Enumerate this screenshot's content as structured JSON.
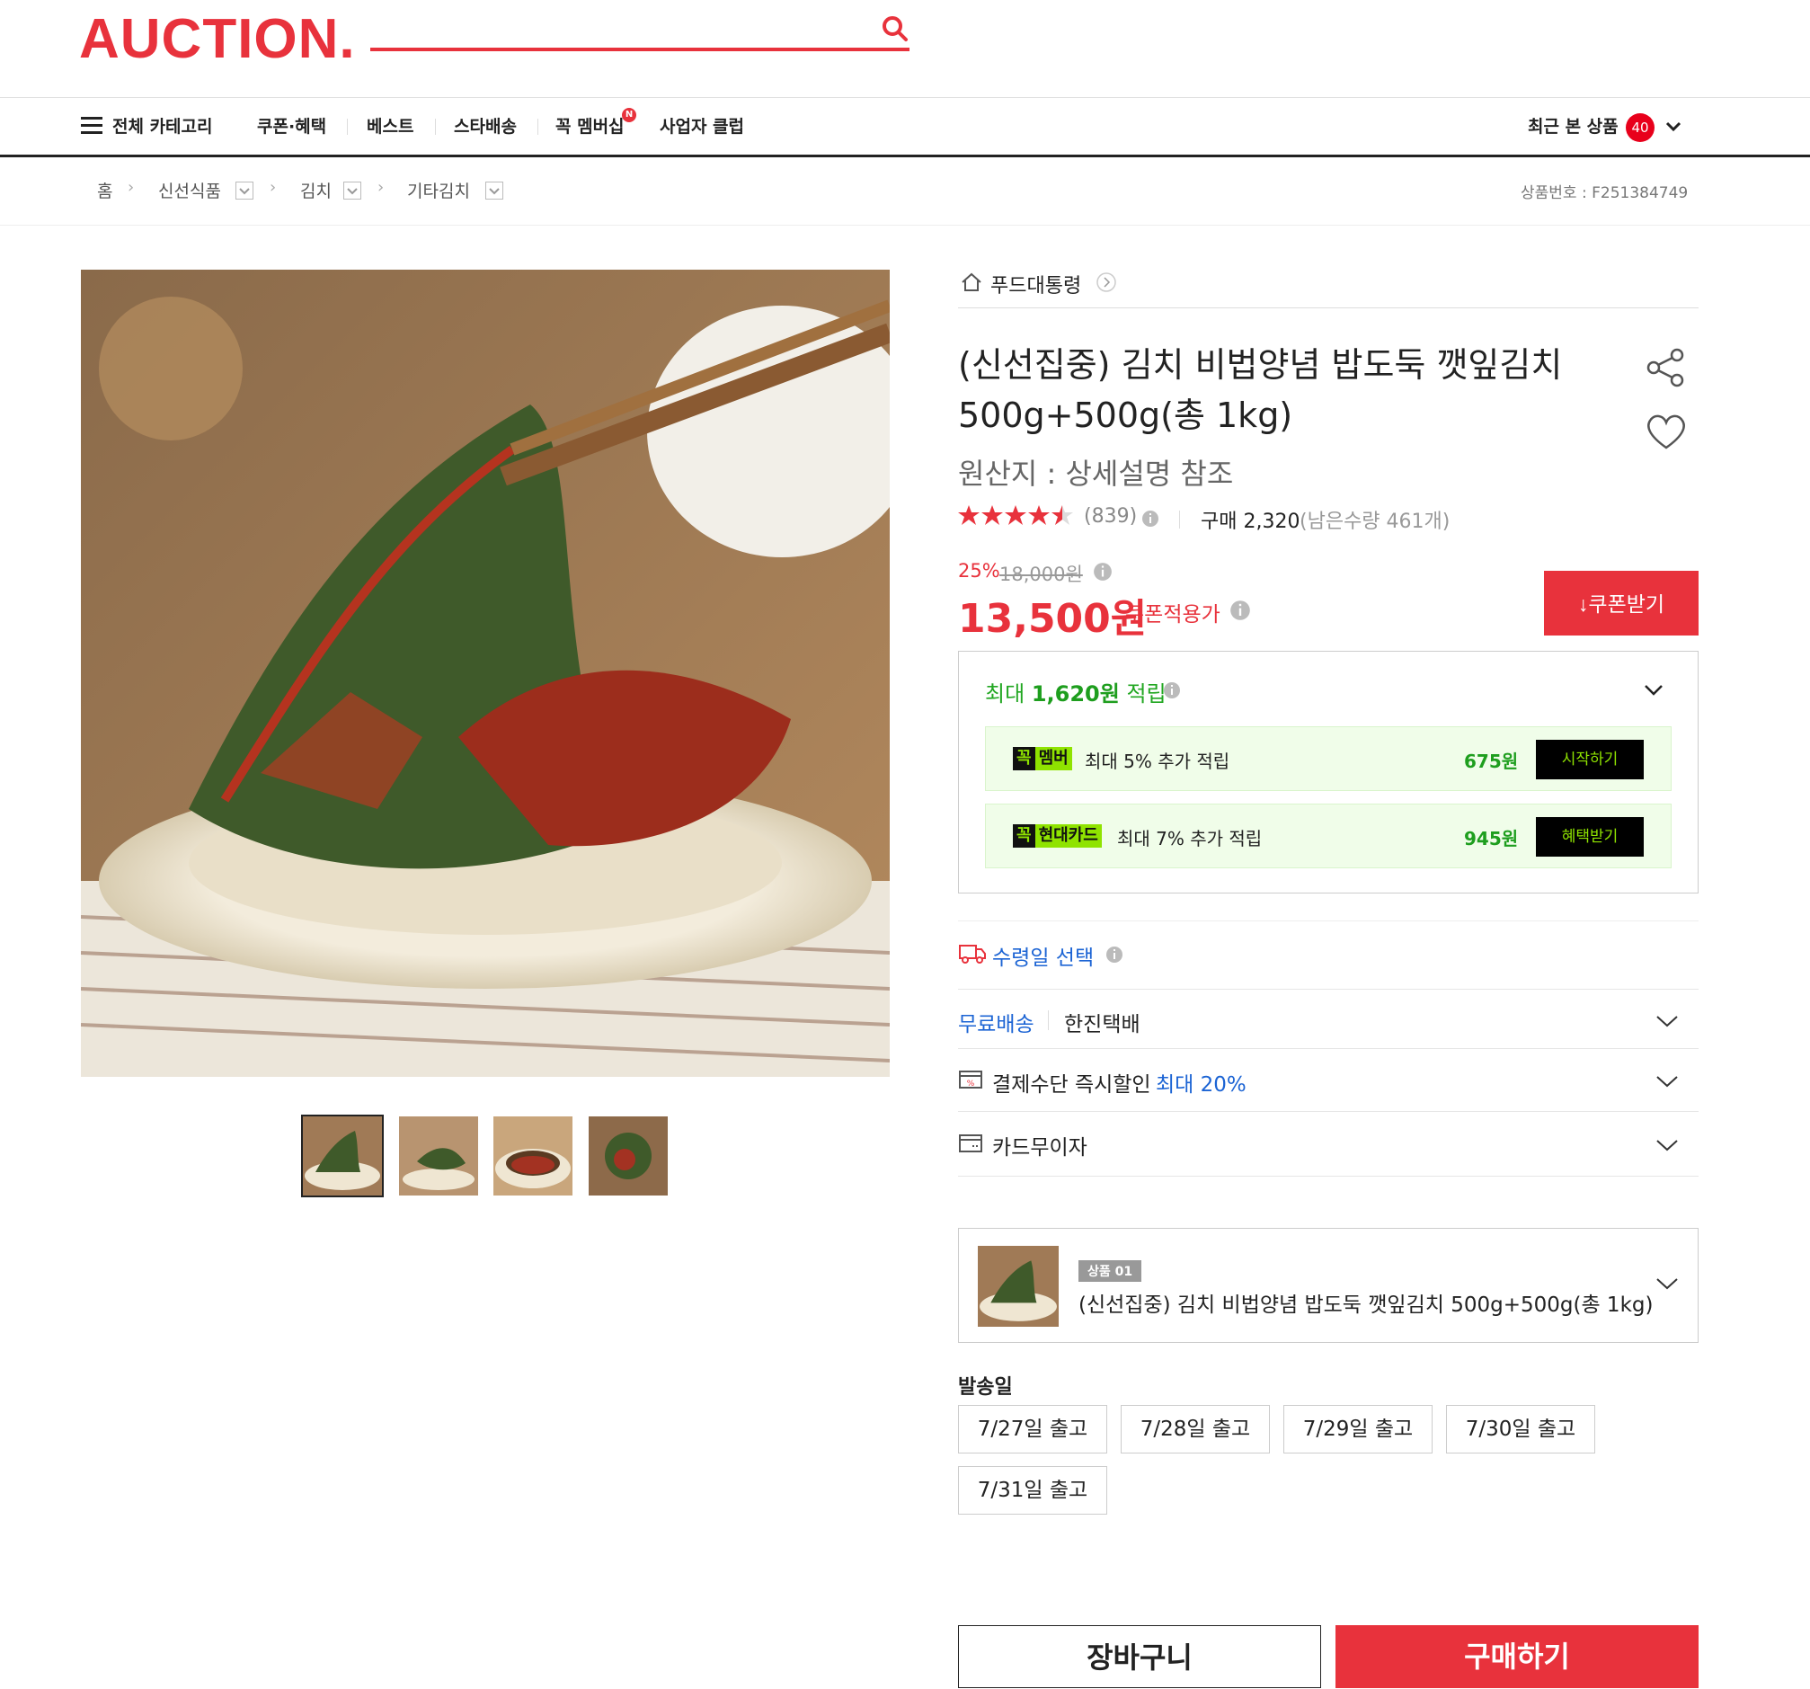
{
  "header": {
    "logo": "AUCTION."
  },
  "nav": {
    "all_categories": "전체 카테고리",
    "items": [
      "쿠폰·혜택",
      "베스트",
      "스타배송",
      "꼭 멤버십",
      "사업자 클럽"
    ],
    "new_badge": "N",
    "recent_label": "최근 본 상품",
    "recent_count": "40"
  },
  "breadcrumb": {
    "home": "홈",
    "levels": [
      "신선식품",
      "김치",
      "기타김치"
    ],
    "product_no_label": "상품번호 : F251384749"
  },
  "product": {
    "store": "푸드대통령",
    "title": "(신선집중) 김치 비법양념 밥도둑 깻잎김치 500g+500g(총 1kg)",
    "origin": "원산지 : 상세설명 참조",
    "rating_stars": 4.5,
    "review_count": "(839)",
    "purchase_count": "구매 2,320",
    "remaining": "(남은수량 461개)",
    "discount": "25%",
    "original_price": "18,000원",
    "price": "13,500원",
    "price_label": "쿠폰적용가",
    "coupon_button": "쿠폰받기"
  },
  "rewards": {
    "prefix": "최대",
    "amount": "1,620원",
    "suffix": "적립",
    "benefits": [
      {
        "tag_k": "꼭",
        "tag_g": "멤버",
        "text": "최대 5% 추가 적립",
        "amount": "675원",
        "button": "시작하기"
      },
      {
        "tag_k": "꼭",
        "tag_g": "현대카드",
        "text": "최대 7% 추가 적립",
        "amount": "945원",
        "button": "혜택받기"
      }
    ]
  },
  "delivery": {
    "pickup_title": "수령일 선택",
    "free_shipping": "무료배송",
    "courier": "한진택배",
    "payment_discount": "결제수단 즉시할인",
    "payment_max": "최대 20%",
    "installment": "카드무이자"
  },
  "option": {
    "tag": "상품 01",
    "name": "(신선집중) 김치 비법양념 밥도둑 깻잎김치 500g+500g(총 1kg)"
  },
  "shipping": {
    "title": "발송일",
    "dates": [
      "7/27일 출고",
      "7/28일 출고",
      "7/29일 출고",
      "7/30일 출고",
      "7/31일 출고"
    ]
  },
  "actions": {
    "cart": "장바구니",
    "buy": "구매하기"
  },
  "colors": {
    "brand": "#e8323c",
    "reward_green": "#1e9e1e",
    "link_blue": "#1c64d4"
  }
}
